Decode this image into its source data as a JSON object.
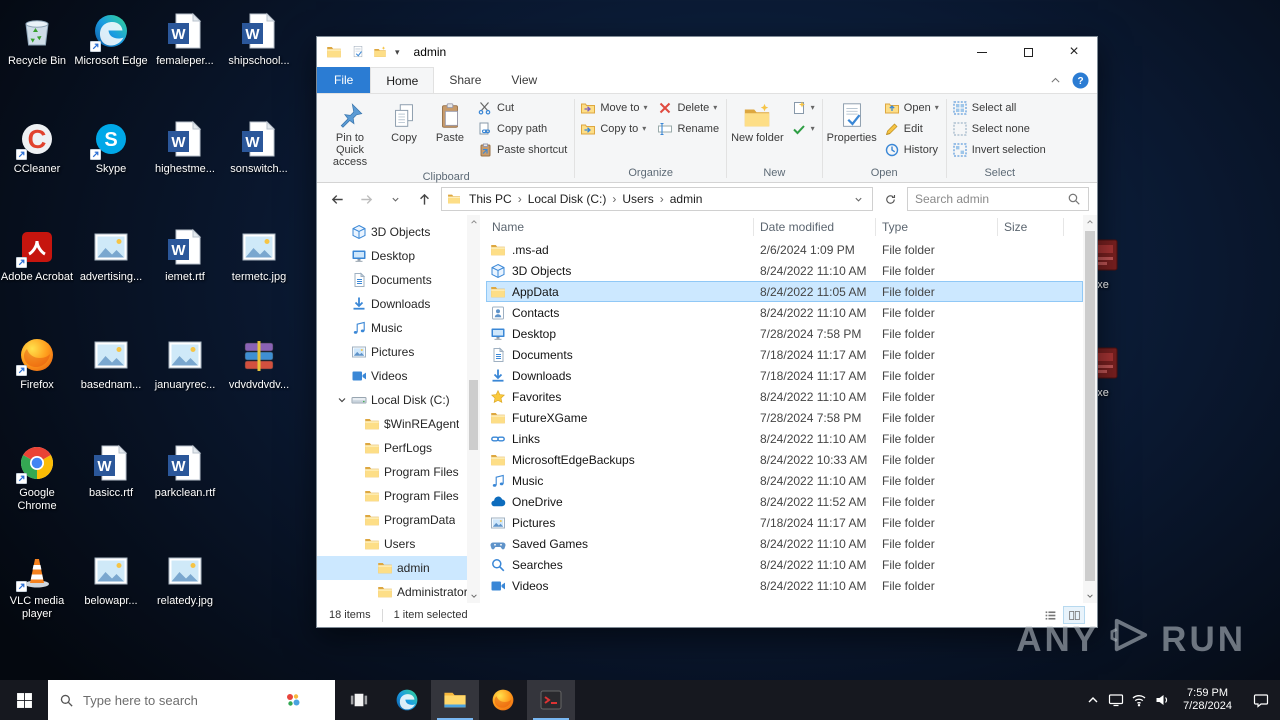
{
  "watermark": {
    "left": "ANY",
    "right": "RUN"
  },
  "desktop": {
    "icons": [
      {
        "label": "Recycle Bin",
        "icon": "recycle-bin",
        "col": 0,
        "row": 0
      },
      {
        "label": "CCleaner",
        "icon": "ccleaner",
        "col": 0,
        "row": 1,
        "shortcut": true
      },
      {
        "label": "Adobe Acrobat",
        "icon": "acrobat",
        "col": 0,
        "row": 2,
        "shortcut": true
      },
      {
        "label": "Firefox",
        "icon": "firefox",
        "col": 0,
        "row": 3,
        "shortcut": true
      },
      {
        "label": "Google Chrome",
        "icon": "chrome",
        "col": 0,
        "row": 4,
        "shortcut": true
      },
      {
        "label": "VLC media player",
        "icon": "vlc",
        "col": 0,
        "row": 5,
        "shortcut": true
      },
      {
        "label": "Microsoft Edge",
        "icon": "edge",
        "col": 1,
        "row": 0,
        "shortcut": true
      },
      {
        "label": "Skype",
        "icon": "skype",
        "col": 1,
        "row": 1,
        "shortcut": true
      },
      {
        "label": "advertising...",
        "icon": "image",
        "col": 1,
        "row": 2
      },
      {
        "label": "basednam...",
        "icon": "image",
        "col": 1,
        "row": 3
      },
      {
        "label": "basicc.rtf",
        "icon": "word",
        "col": 1,
        "row": 4
      },
      {
        "label": "belowapr...",
        "icon": "image",
        "col": 1,
        "row": 5
      },
      {
        "label": "femaleper...",
        "icon": "word",
        "col": 2,
        "row": 0
      },
      {
        "label": "highestme...",
        "icon": "word",
        "col": 2,
        "row": 1
      },
      {
        "label": "iemet.rtf",
        "icon": "word",
        "col": 2,
        "row": 2
      },
      {
        "label": "januaryrec...",
        "icon": "image",
        "col": 2,
        "row": 3
      },
      {
        "label": "parkclean.rtf",
        "icon": "word",
        "col": 2,
        "row": 4
      },
      {
        "label": "relatedy.jpg",
        "icon": "image",
        "col": 2,
        "row": 5
      },
      {
        "label": "shipschool...",
        "icon": "word",
        "col": 3,
        "row": 0
      },
      {
        "label": "sonswitch...",
        "icon": "word",
        "col": 3,
        "row": 1
      },
      {
        "label": "termetc.jpg",
        "icon": "image",
        "col": 3,
        "row": 2
      },
      {
        "label": "vdvdvdvdv...",
        "icon": "winrar",
        "col": 3,
        "row": 3
      }
    ],
    "edge_icons": [
      {
        "label": "xe",
        "icon": "exe"
      },
      {
        "label": "xe",
        "icon": "exe"
      }
    ]
  },
  "explorer": {
    "title": "admin",
    "tabs": [
      {
        "label": "File",
        "type": "file"
      },
      {
        "label": "Home",
        "active": true
      },
      {
        "label": "Share"
      },
      {
        "label": "View"
      }
    ],
    "ribbon_groups": [
      {
        "label": "Clipboard",
        "large": [
          {
            "label": "Pin to Quick access",
            "icon": "pin"
          },
          {
            "label": "Copy",
            "icon": "copy"
          },
          {
            "label": "Paste",
            "icon": "paste"
          }
        ],
        "cols": [
          [
            {
              "label": "Cut",
              "icon": "cut"
            },
            {
              "label": "Copy path",
              "icon": "copy-path"
            },
            {
              "label": "Paste shortcut",
              "icon": "paste-shortcut"
            }
          ]
        ]
      },
      {
        "label": "Organize",
        "large": [],
        "cols": [
          [
            {
              "label": "Move to",
              "icon": "move-to",
              "dropdown": true
            },
            {
              "label": "Copy to",
              "icon": "copy-to",
              "dropdown": true
            }
          ],
          [
            {
              "label": "Delete",
              "icon": "delete",
              "dropdown": true
            },
            {
              "label": "Rename",
              "icon": "rename"
            }
          ]
        ]
      },
      {
        "label": "New",
        "large": [
          {
            "label": "New folder",
            "icon": "new-folder"
          }
        ],
        "cols": [
          [
            {
              "label": "",
              "icon": "new-item",
              "dropdown": true
            },
            {
              "label": "",
              "icon": "easy-access",
              "dropdown": true
            }
          ]
        ]
      },
      {
        "label": "Open",
        "large": [
          {
            "label": "Properties",
            "icon": "properties"
          }
        ],
        "cols": [
          [
            {
              "label": "Open",
              "icon": "open",
              "dropdown": true
            },
            {
              "label": "Edit",
              "icon": "edit"
            },
            {
              "label": "History",
              "icon": "history"
            }
          ]
        ]
      },
      {
        "label": "Select",
        "large": [],
        "cols": [
          [
            {
              "label": "Select all",
              "icon": "select-all"
            },
            {
              "label": "Select none",
              "icon": "select-none"
            },
            {
              "label": "Invert selection",
              "icon": "invert-selection"
            }
          ]
        ]
      }
    ],
    "address": {
      "crumbs": [
        "This PC",
        "Local Disk (C:)",
        "Users",
        "admin"
      ],
      "search_placeholder": "Search admin"
    },
    "nav_items": [
      {
        "label": "3D Objects",
        "icon": "cube",
        "indent": 1
      },
      {
        "label": "Desktop",
        "icon": "monitor",
        "indent": 1
      },
      {
        "label": "Documents",
        "icon": "document",
        "indent": 1
      },
      {
        "label": "Downloads",
        "icon": "downloads",
        "indent": 1
      },
      {
        "label": "Music",
        "icon": "music",
        "indent": 1
      },
      {
        "label": "Pictures",
        "icon": "pictures",
        "indent": 1
      },
      {
        "label": "Videos",
        "icon": "videos",
        "indent": 1
      },
      {
        "label": "Local Disk (C:)",
        "icon": "drive",
        "indent": 1,
        "expanded": true
      },
      {
        "label": "$WinREAgent",
        "icon": "folder",
        "indent": 2
      },
      {
        "label": "PerfLogs",
        "icon": "folder",
        "indent": 2
      },
      {
        "label": "Program Files",
        "icon": "folder",
        "indent": 2
      },
      {
        "label": "Program Files",
        "icon": "folder",
        "indent": 2
      },
      {
        "label": "ProgramData",
        "icon": "folder",
        "indent": 2
      },
      {
        "label": "Users",
        "icon": "folder",
        "indent": 2
      },
      {
        "label": "admin",
        "icon": "folder",
        "indent": 3,
        "selected": true
      },
      {
        "label": "Administrator",
        "icon": "folder",
        "indent": 3
      }
    ],
    "list": {
      "columns": [
        "Name",
        "Date modified",
        "Type",
        "Size"
      ],
      "rows": [
        {
          "name": ".ms-ad",
          "icon": "folder",
          "date": "2/6/2024 1:09 PM",
          "type": "File folder",
          "size": ""
        },
        {
          "name": "3D Objects",
          "icon": "cube",
          "date": "8/24/2022 11:10 AM",
          "type": "File folder",
          "size": ""
        },
        {
          "name": "AppData",
          "icon": "folder",
          "date": "8/24/2022 11:05 AM",
          "type": "File folder",
          "size": "",
          "selected": true
        },
        {
          "name": "Contacts",
          "icon": "contacts",
          "date": "8/24/2022 11:10 AM",
          "type": "File folder",
          "size": ""
        },
        {
          "name": "Desktop",
          "icon": "monitor",
          "date": "7/28/2024 7:58 PM",
          "type": "File folder",
          "size": ""
        },
        {
          "name": "Documents",
          "icon": "document",
          "date": "7/18/2024 11:17 AM",
          "type": "File folder",
          "size": ""
        },
        {
          "name": "Downloads",
          "icon": "downloads",
          "date": "7/18/2024 11:17 AM",
          "type": "File folder",
          "size": ""
        },
        {
          "name": "Favorites",
          "icon": "star",
          "date": "8/24/2022 11:10 AM",
          "type": "File folder",
          "size": ""
        },
        {
          "name": "FutureXGame",
          "icon": "folder",
          "date": "7/28/2024 7:58 PM",
          "type": "File folder",
          "size": ""
        },
        {
          "name": "Links",
          "icon": "links",
          "date": "8/24/2022 11:10 AM",
          "type": "File folder",
          "size": ""
        },
        {
          "name": "MicrosoftEdgeBackups",
          "icon": "folder",
          "date": "8/24/2022 10:33 AM",
          "type": "File folder",
          "size": ""
        },
        {
          "name": "Music",
          "icon": "music",
          "date": "8/24/2022 11:10 AM",
          "type": "File folder",
          "size": ""
        },
        {
          "name": "OneDrive",
          "icon": "cloud",
          "date": "8/24/2022 11:52 AM",
          "type": "File folder",
          "size": ""
        },
        {
          "name": "Pictures",
          "icon": "pictures",
          "date": "7/18/2024 11:17 AM",
          "type": "File folder",
          "size": ""
        },
        {
          "name": "Saved Games",
          "icon": "gamepad",
          "date": "8/24/2022 11:10 AM",
          "type": "File folder",
          "size": ""
        },
        {
          "name": "Searches",
          "icon": "search",
          "date": "8/24/2022 11:10 AM",
          "type": "File folder",
          "size": ""
        },
        {
          "name": "Videos",
          "icon": "videos",
          "date": "8/24/2022 11:10 AM",
          "type": "File folder",
          "size": ""
        }
      ]
    },
    "status": {
      "items": "18 items",
      "selected": "1 item selected"
    }
  },
  "taskbar": {
    "search_placeholder": "Type here to search",
    "apps": [
      {
        "name": "task-view",
        "icon": "taskview"
      },
      {
        "name": "edge",
        "icon": "edge"
      },
      {
        "name": "file-explorer",
        "icon": "explorer",
        "active": true
      },
      {
        "name": "firefox",
        "icon": "firefox"
      },
      {
        "name": "running-sample",
        "icon": "sample",
        "active": true
      }
    ],
    "tray": [
      {
        "icon": "chevron-up"
      },
      {
        "icon": "display"
      },
      {
        "icon": "network"
      },
      {
        "icon": "volume"
      }
    ],
    "clock": {
      "time": "7:59 PM",
      "date": "7/28/2024"
    }
  }
}
